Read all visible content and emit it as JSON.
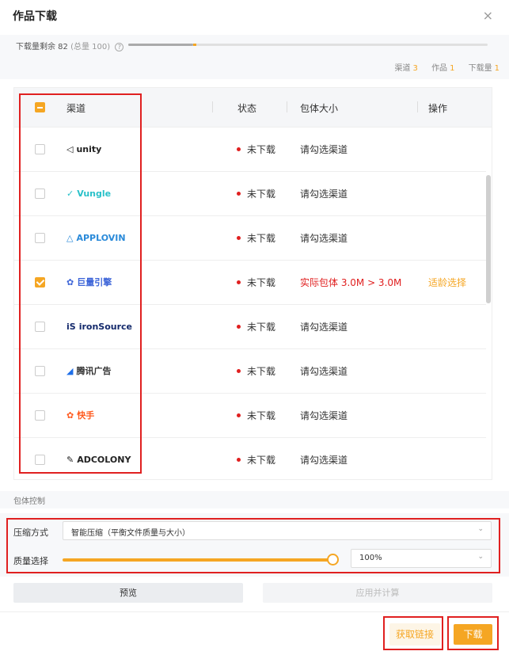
{
  "dialog": {
    "title": "作品下载",
    "close_icon": "×"
  },
  "quota": {
    "prefix": "下载量剩余 82",
    "total": "(总量 100)",
    "used_fraction": 0.18,
    "stats": [
      {
        "label": "渠道",
        "value": "3"
      },
      {
        "label": "作品",
        "value": "1"
      },
      {
        "label": "下载量",
        "value": "1"
      }
    ]
  },
  "table": {
    "headers": {
      "channel": "渠道",
      "status": "状态",
      "size": "包体大小",
      "op": "操作"
    },
    "rows": [
      {
        "channel": "unity",
        "mark": "◁",
        "mark_color": "#222222",
        "text_color": "#222222",
        "status": "未下载",
        "size": "请勾选渠道",
        "op": "",
        "checked": false
      },
      {
        "channel": "Vungle",
        "mark": "✓",
        "mark_color": "#2ac1c9",
        "text_color": "#2ac1c9",
        "status": "未下载",
        "size": "请勾选渠道",
        "op": "",
        "checked": false
      },
      {
        "channel": "APPLOVIN",
        "mark": "△",
        "mark_color": "#2a8ad9",
        "text_color": "#2a8ad9",
        "status": "未下载",
        "size": "请勾选渠道",
        "op": "",
        "checked": false
      },
      {
        "channel": "巨量引擎",
        "mark": "✿",
        "mark_color": "#3c64d8",
        "text_color": "#3c64d8",
        "status": "未下载",
        "size": "实际包体 3.0M > 3.0M",
        "op": "适龄选择",
        "checked": true,
        "warn": true
      },
      {
        "channel": "ironSource",
        "mark": "iS",
        "mark_color": "#13296b",
        "text_color": "#13296b",
        "status": "未下载",
        "size": "请勾选渠道",
        "op": "",
        "checked": false
      },
      {
        "channel": "腾讯广告",
        "mark": "◢",
        "mark_color": "#1f6fe8",
        "text_color": "#333333",
        "status": "未下载",
        "size": "请勾选渠道",
        "op": "",
        "checked": false
      },
      {
        "channel": "快手",
        "mark": "✿",
        "mark_color": "#ff5a1f",
        "text_color": "#ff5a1f",
        "status": "未下载",
        "size": "请勾选渠道",
        "op": "",
        "checked": false
      },
      {
        "channel": "ADCOLONY",
        "mark": "✎",
        "mark_color": "#222222",
        "text_color": "#222222",
        "status": "未下载",
        "size": "请勾选渠道",
        "op": "",
        "checked": false
      }
    ]
  },
  "package_control": {
    "section_label": "包体控制",
    "compression_label": "压缩方式",
    "compression_value": "智能压缩（平衡文件质量与大小）",
    "quality_label": "质量选择",
    "quality_value": "100%",
    "quality_level": 1.0,
    "preview_button": "预览",
    "apply_button": "应用并计算"
  },
  "footer": {
    "get_link": "获取链接",
    "download": "下载"
  },
  "colors": {
    "accent": "#f5a623",
    "danger": "#e02020"
  }
}
